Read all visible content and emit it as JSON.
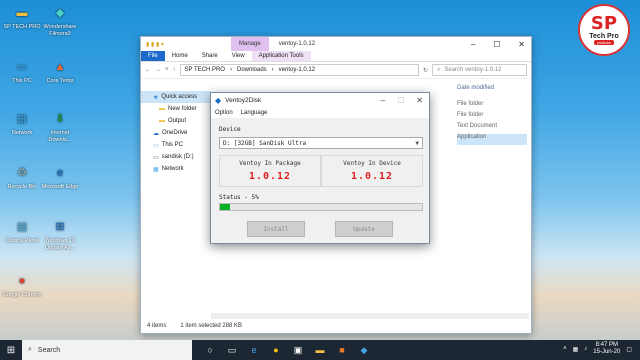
{
  "desktop": {
    "icons": [
      {
        "label": "SP TECH PRO",
        "glyph": "folder-icon"
      },
      {
        "label": "Wondershare Filmora9",
        "glyph": "filmora-icon"
      },
      {
        "label": "This PC",
        "glyph": "pc-icon"
      },
      {
        "label": "Core Temp",
        "glyph": "thermometer-icon"
      },
      {
        "label": "Network",
        "glyph": "network-icon"
      },
      {
        "label": "Internet Downlo...",
        "glyph": "download-icon"
      },
      {
        "label": "Recycle Bin",
        "glyph": "recycle-icon"
      },
      {
        "label": "Microsoft Edge",
        "glyph": "edge-icon"
      },
      {
        "label": "Control Panel",
        "glyph": "control-panel-icon"
      },
      {
        "label": "Windows 10 Update As...",
        "glyph": "windows-icon"
      },
      {
        "label": "Google Chrome",
        "glyph": "chrome-icon"
      }
    ],
    "logo": {
      "main": "SP",
      "name": "Tech Pro",
      "sub": "youtube"
    }
  },
  "explorer": {
    "manage_tab": "Manage",
    "title": "ventoy-1.0.12",
    "ribbon": [
      "File",
      "Home",
      "Share",
      "View",
      "Application Tools"
    ],
    "address": {
      "root": "SP TECH PRO",
      "parts": [
        "Downloads",
        "ventoy-1.0.12"
      ]
    },
    "search_placeholder": "Search ventoy-1.0.12",
    "nav": [
      {
        "label": "Quick access",
        "selected": true,
        "sub": false
      },
      {
        "label": "New folder",
        "selected": false,
        "sub": true
      },
      {
        "label": "Output",
        "selected": false,
        "sub": true
      },
      {
        "label": "OneDrive",
        "selected": false,
        "sub": false
      },
      {
        "label": "This PC",
        "selected": false,
        "sub": false
      },
      {
        "label": "sandisk (D:)",
        "selected": false,
        "sub": false
      },
      {
        "label": "Network",
        "selected": false,
        "sub": false
      }
    ],
    "column_header": "Date modified",
    "type_values": [
      "File folder",
      "File folder",
      "Text Document",
      "Application"
    ],
    "status": {
      "items": "4 items",
      "selected": "1 item selected  288 KB"
    }
  },
  "ventoy": {
    "title": "Ventoy2Disk",
    "menu": [
      "Option",
      "Language"
    ],
    "device_label": "Device",
    "device_value": "D: [32GB] SanDisk Ultra",
    "package_label": "Ventoy In Package",
    "package_version": "1.0.12",
    "device_version_label": "Ventoy In Device",
    "device_version": "1.0.12",
    "status_label": "Status - 5%",
    "progress_percent": 5,
    "install_label": "Install",
    "update_label": "Update"
  },
  "taskbar": {
    "search_label": "Search",
    "time": "8:47 PM",
    "date": "15-Jun-20"
  },
  "colors": {
    "accent": "#1b6ac9",
    "progress": "#06b025",
    "version": "#e02020"
  }
}
